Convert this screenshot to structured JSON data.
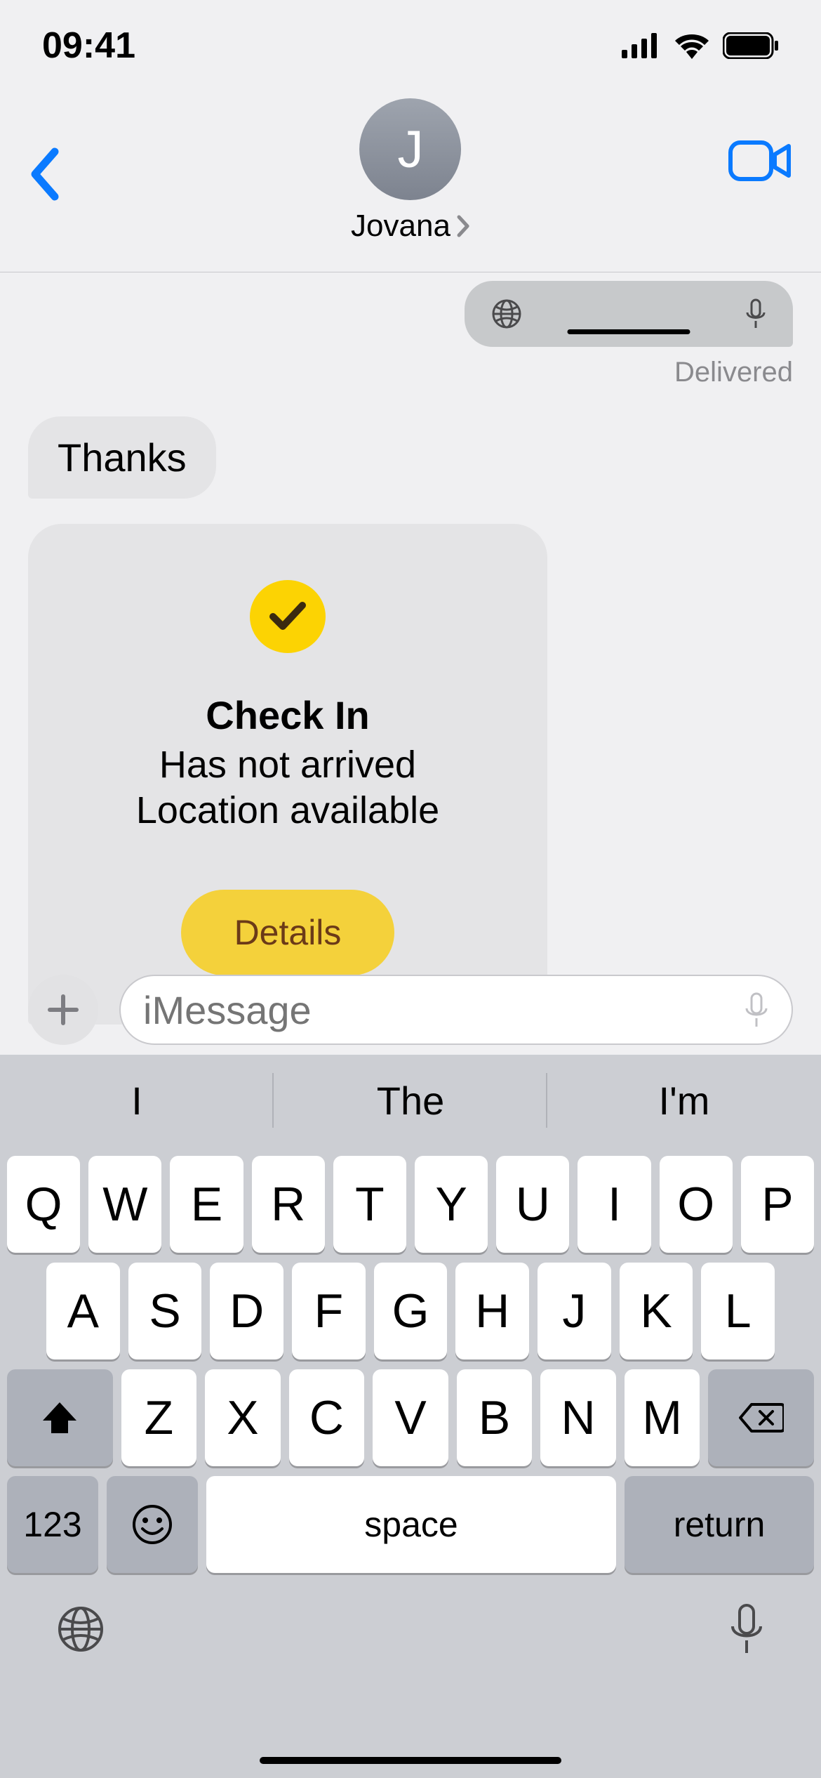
{
  "status": {
    "time": "09:41"
  },
  "header": {
    "contact_initial": "J",
    "contact_name": "Jovana"
  },
  "conversation": {
    "delivered_label": "Delivered",
    "thanks_text": "Thanks",
    "checkin": {
      "title": "Check In",
      "line1": "Has not arrived",
      "line2": "Location available",
      "details_label": "Details"
    }
  },
  "composer": {
    "placeholder": "iMessage"
  },
  "keyboard": {
    "predictions": [
      "I",
      "The",
      "I'm"
    ],
    "row1": [
      "Q",
      "W",
      "E",
      "R",
      "T",
      "Y",
      "U",
      "I",
      "O",
      "P"
    ],
    "row2": [
      "A",
      "S",
      "D",
      "F",
      "G",
      "H",
      "J",
      "K",
      "L"
    ],
    "row3": [
      "Z",
      "X",
      "C",
      "V",
      "B",
      "N",
      "M"
    ],
    "numbers_label": "123",
    "space_label": "space",
    "return_label": "return"
  }
}
